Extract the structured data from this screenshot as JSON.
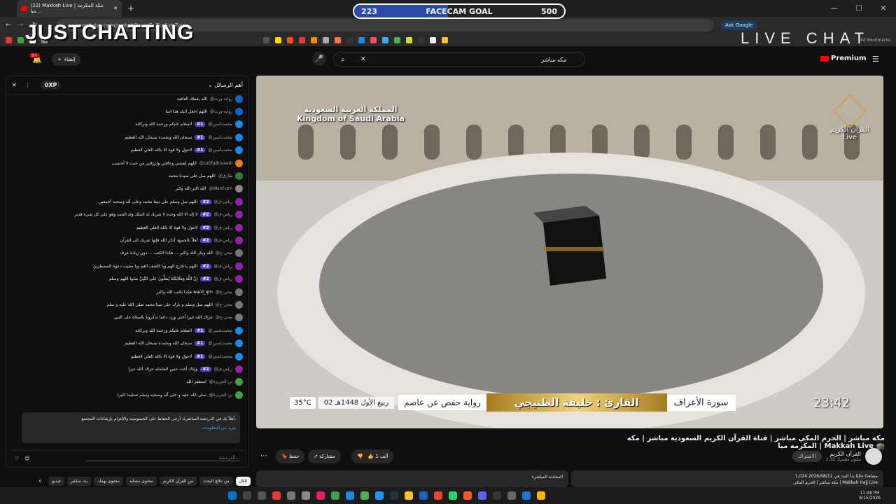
{
  "browser": {
    "tab_title": "(22) Makkah Live | مكة المكرمة مبا...",
    "url": "youtube.com/watch?v=yG_Z-x6zhZg",
    "ask_google": "Ask Google",
    "all_bookmarks": "All Bookmarks"
  },
  "overlay": {
    "goal_label": "FACECAM GOAL",
    "goal_current": "223",
    "goal_target": "500",
    "goal_progress": 0.446,
    "title_left": "JUSTCHATTING",
    "title_right": "LIVE CHAT"
  },
  "youtube": {
    "create_label": "إنشاء",
    "notif_count": "9+",
    "search_query": "مكه مباشر",
    "premium_label": "Premium"
  },
  "chat": {
    "xp": "0XP",
    "sort_label": "أهم الرسائل",
    "messages": [
      {
        "author": "@رواية-ورث",
        "badge": "",
        "text": "الله يعطك العافية",
        "color": "#1565c0"
      },
      {
        "author": "@رواية-ورث",
        "badge": "",
        "text": "اللهم اجعل البلد هذا امنا",
        "color": "#1565c0"
      },
      {
        "author": "@محمدياسين",
        "badge": "#1",
        "text": "السلام عليكم ورحمة الله وبركاته",
        "color": "#1e88e5"
      },
      {
        "author": "@محمدياسين",
        "badge": "#1",
        "text": "سبحان الله وبحمده سبحان الله العظيم",
        "color": "#1e88e5"
      },
      {
        "author": "@محمدياسين",
        "badge": "#1",
        "text": "لاحول ولا قوة الا بالله العلي العظيم",
        "color": "#1e88e5"
      },
      {
        "author": "@LatifaBouaadi",
        "badge": "",
        "text": "اللهم إشفني وعافني وارزقني من حيث لا أحتسب",
        "color": "#e67e22"
      },
      {
        "author": "@طارق",
        "badge": "",
        "text": "اللهم صل على سيدنا محمد",
        "color": "#2e7d32"
      },
      {
        "author": "@Ward-qrn",
        "badge": "",
        "text": "الله اكبر الله وكبر",
        "color": "#888888"
      },
      {
        "author": "@رياض-ق",
        "badge": "#2",
        "text": "اللهم صل وسلم على نبينا محمد وعلى آله وصحبه أجمعين",
        "color": "#8e24aa"
      },
      {
        "author": "@رياض-ق",
        "badge": "#2",
        "text": "لا إله الا الله وحده لا شريك له الملك وله الحمد وهو على كل شيء قدير",
        "color": "#8e24aa"
      },
      {
        "author": "@رياض-ق",
        "badge": "#2",
        "text": "لاحول ولا قوة الا بالله العلي العظيم",
        "color": "#8e24aa"
      },
      {
        "author": "@رياض-ق",
        "badge": "#2",
        "text": "أهلاً بالجميع، أذكر الله فإنها تقربك الى القرآن",
        "color": "#8e24aa"
      },
      {
        "author": "@محي-ح",
        "badge": "",
        "text": "الله وبكر الله واكبر ... هكذا الكتب ... دون زيادة حرف",
        "color": "#777777"
      },
      {
        "author": "@رياض-ق",
        "badge": "#2",
        "text": "اللهم يا فارج الهم ويا كاشف الغم ويا مجيب دعوة المضطرين",
        "color": "#8e24aa"
      },
      {
        "author": "@رياض-ق",
        "badge": "#2",
        "text": "إِنَّ اللَّهَ وَمَلَائِكَتَهُ يُصَلُّونَ عَلَى النَّبِيِّ صلوا اللهم وسلم",
        "color": "#8e24aa"
      },
      {
        "author": "@محي-ح",
        "badge": "",
        "text": "هكذا تكتب الله واكبر ward_qrn",
        "color": "#777777"
      },
      {
        "author": "@محي-ح",
        "badge": "",
        "text": "اللهم صل وسلم و بارك على نبينا محمد صلى الله عليه و سلم",
        "color": "#777777"
      },
      {
        "author": "@محي-ح",
        "badge": "",
        "text": "جزاك الله خيرا أختي ورد، دائما تذكرونا بالصلاة على النبي",
        "color": "#777777"
      },
      {
        "author": "@محمدياسين",
        "badge": "#1",
        "text": "السلام عليكم ورحمة الله وبركاته",
        "color": "#1e88e5"
      },
      {
        "author": "@محمدياسين",
        "badge": "#1",
        "text": "سبحان الله وبحمده سبحان الله العظيم",
        "color": "#1e88e5"
      },
      {
        "author": "@محمدياسين",
        "badge": "#1",
        "text": "لاحول ولا قوة الا بالله العلي العظيم",
        "color": "#1e88e5"
      },
      {
        "author": "@رياض-ق",
        "badge": "#2",
        "text": "وإياك أخت حنين الفاضله جزاك الله خيرا",
        "color": "#8e24aa"
      },
      {
        "author": "@بن-الجزيرة",
        "badge": "",
        "text": "استغفر الله",
        "color": "#43a047"
      },
      {
        "author": "@بن-الجزيرة",
        "badge": "",
        "text": "صلى الله عليه و على آله وصحبه وسلم تسليما كثيرا",
        "color": "#43a047"
      }
    ],
    "pinned_text": "أهلاً بك في الدردشة المباشرة، أرجى الحفاظ على الخصوصية والالتزام بإرشادات المجتمع.",
    "pinned_more": "مزيد من المعلومات",
    "input_placeholder": "الدردشة..."
  },
  "video": {
    "badge_country_ar": "المملكة العربية السعودية",
    "badge_country_en": "Kingdom of Saudi Arabia",
    "channel_logo_ar": "القرآن الكريم",
    "channel_logo_en": "Live",
    "surah": "سورة الأعراف",
    "reciter": "القارئ : خليفة الطنيجي",
    "narration": "رواية حفص عن عاصم",
    "hijri_date": "02 ربيع الأول 1448هـ",
    "temperature": "35°C",
    "clock": "23:42",
    "title": "مكة مباشر | الحرم المكي مباشر | قناة القرآن الكريم السعودية مباشر | مكه المكرمه مبا | Makkah Live 🕋"
  },
  "actions": {
    "likes": "1 ألف",
    "share": "مشاركة",
    "save": "حفظ",
    "channel_name": "القرآن الكريم",
    "subscribers": "1.32 مليون مشترك",
    "subscribe": "الاشتراك"
  },
  "chips": [
    "الكل",
    "من نتائج البحث",
    "من القرآن الكريم",
    "محتوى مشابه",
    "محتوى يهمك",
    "بث مباشر",
    "فيديو"
  ],
  "description": {
    "stats": "1,024 مشاهدًا حاليًا بدأ البث في 2026/08/11",
    "line2": "مكة مباشر | الحرم المكي | Makkah Hajj Live"
  },
  "live_chat_box": "المحادثة المباشرة",
  "taskbar": {
    "time": "11:46 PM",
    "date": "8/15/2026"
  }
}
